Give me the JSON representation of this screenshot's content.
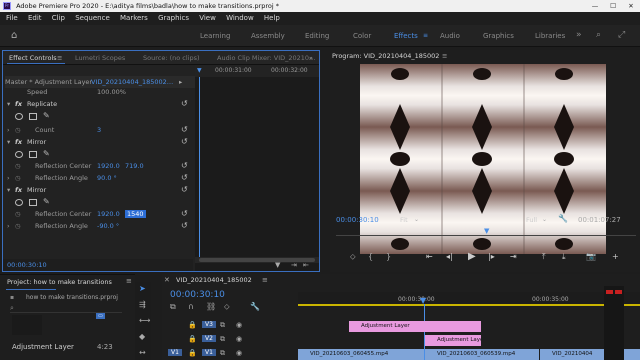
{
  "titlebar": {
    "title": "Adobe Premiere Pro 2020 - E:\\aditya films\\badla\\how to make transitions.prproj *",
    "logo": "Pr",
    "minimize": "—",
    "maximize": "☐",
    "close": "✕"
  },
  "menu": [
    "File",
    "Edit",
    "Clip",
    "Sequence",
    "Markers",
    "Graphics",
    "View",
    "Window",
    "Help"
  ],
  "workspaces": [
    "Learning",
    "Assembly",
    "Editing",
    "Color",
    "Effects",
    "Audio",
    "Graphics",
    "Libraries"
  ],
  "active_workspace": "Effects",
  "ec": {
    "tabs": [
      "Effect Controls",
      "Lumetri Scopes",
      "Source: (no clips)",
      "Audio Clip Mixer: VID_20210…"
    ],
    "master": "Master * Adjustment Layer",
    "clip": "VID_20210404_185002…",
    "speed_label": "Speed",
    "speed_value": "100.00%",
    "replicate": "Replicate",
    "count_label": "Count",
    "count_value": "3",
    "mirror1": "Mirror",
    "rc1_label": "Reflection Center",
    "rc1_x": "1920.0",
    "rc1_y": "719.0",
    "ra1_label": "Reflection Angle",
    "ra1_value": "90.0 °",
    "mirror2": "Mirror",
    "rc2_label": "Reflection Center",
    "rc2_x": "1920.0",
    "rc2_y": "1540",
    "ra2_label": "Reflection Angle",
    "ra2_value": "-90.0 °",
    "fx": "fx",
    "timecode": "00:00:30:10",
    "ruler": [
      "00:00:31:00",
      "00:00:32:00"
    ]
  },
  "program": {
    "title": "Program: VID_20210404_185002",
    "timecode": "00:00:30:10",
    "fit": "Fit",
    "quality": "Full",
    "duration": "00:01:07:27"
  },
  "project": {
    "title": "Project: how to make transitions",
    "file": "how to make transitions.prproj",
    "item": "Adjustment Layer",
    "item_duration": "4:23"
  },
  "timeline": {
    "seq_tab": "VID_20210404_185002",
    "timecode": "00:00:30:10",
    "ruler": [
      "00:00:30:00",
      "00:00:35:00"
    ],
    "tracks": [
      "V3",
      "V2",
      "V1"
    ],
    "clips": {
      "v3": "Adjustment Layer",
      "v2": "Adjustment Laye",
      "v1a": "VID_20210603_060455.mp4",
      "v1b": "VID_20210603_060539.mp4",
      "v1c": "VID_20210404"
    }
  },
  "colors": {
    "accent": "#4a8ee6",
    "adjustment_clip": "#e89adf",
    "video_clip": "#7fa4d8"
  }
}
